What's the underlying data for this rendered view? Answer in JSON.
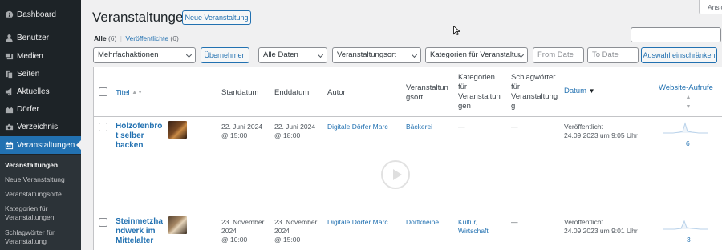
{
  "sidebar": {
    "items": [
      {
        "label": "Dashboard",
        "icon": "dashboard-icon"
      },
      {
        "label": "Benutzer",
        "icon": "users-icon"
      },
      {
        "label": "Medien",
        "icon": "media-icon"
      },
      {
        "label": "Seiten",
        "icon": "pages-icon"
      },
      {
        "label": "Aktuelles",
        "icon": "megaphone-icon"
      },
      {
        "label": "Dörfer",
        "icon": "village-icon"
      },
      {
        "label": "Verzeichnis",
        "icon": "directory-icon"
      },
      {
        "label": "Veranstaltungen",
        "icon": "calendar-icon"
      }
    ],
    "submenu": [
      "Veranstaltungen",
      "Neue Veranstaltung",
      "Veranstaltungsorte",
      "Kategorien für Veranstaltungen",
      "Schlagwörter für Veranstaltung"
    ]
  },
  "header": {
    "title": "Veranstaltungen",
    "add_new": "Neue Veranstaltung",
    "screen_options": "Ansicht"
  },
  "views": {
    "all_label": "Alle",
    "all_count": "(6)",
    "separator": "|",
    "published_label": "Veröffentlichte",
    "published_count": "(6)"
  },
  "filters": {
    "bulk_actions": "Mehrfachaktionen",
    "apply": "Übernehmen",
    "all_dates": "Alle Daten",
    "venue": "Veranstaltungsort",
    "category": "Kategorien für Veranstaltur",
    "from_date_placeholder": "From Date",
    "to_date_placeholder": "To Date",
    "filter_button": "Auswahl einschränken"
  },
  "columns": {
    "title": "Titel",
    "start": "Startdatum",
    "end": "Enddatum",
    "author": "Autor",
    "venue": [
      "Veranstaltun",
      "gsort"
    ],
    "categories": [
      "Kategorien",
      "für",
      "Veranstaltun",
      "gen"
    ],
    "tags": [
      "Schlagwörter",
      "für",
      "Veranstaltung",
      "g"
    ],
    "date": "Datum",
    "views": "Website-Aufrufe"
  },
  "rows": [
    {
      "title": [
        "Holzofenbro",
        "t selber",
        "backen"
      ],
      "start": [
        "22. Juni 2024",
        "@ 15:00"
      ],
      "end": [
        "22. Juni 2024",
        "@ 18:00"
      ],
      "author": "Digitale Dörfer Marc",
      "venue": "Bäckerei",
      "categories": [
        "—"
      ],
      "tags": "—",
      "status": "Veröffentlicht",
      "date": "24.09.2023 um 9:05 Uhr",
      "views": "6"
    },
    {
      "title": [
        "Steinmetzha",
        "ndwerk im",
        "Mittelalter"
      ],
      "start": [
        "23. November",
        "2024",
        "@ 10:00"
      ],
      "end": [
        "23. November",
        "2024",
        "@ 15:00"
      ],
      "author": "Digitale Dörfer Marc",
      "venue": "Dorfkneipe",
      "categories": [
        "Kultur,",
        "Wirtschaft"
      ],
      "tags": "—",
      "status": "Veröffentlicht",
      "date": "24.09.2023 um 9:01 Uhr",
      "views": "3"
    }
  ],
  "colors": {
    "sidebar_bg": "#1d2327",
    "accent": "#2271b1",
    "link": "#2271b1"
  }
}
